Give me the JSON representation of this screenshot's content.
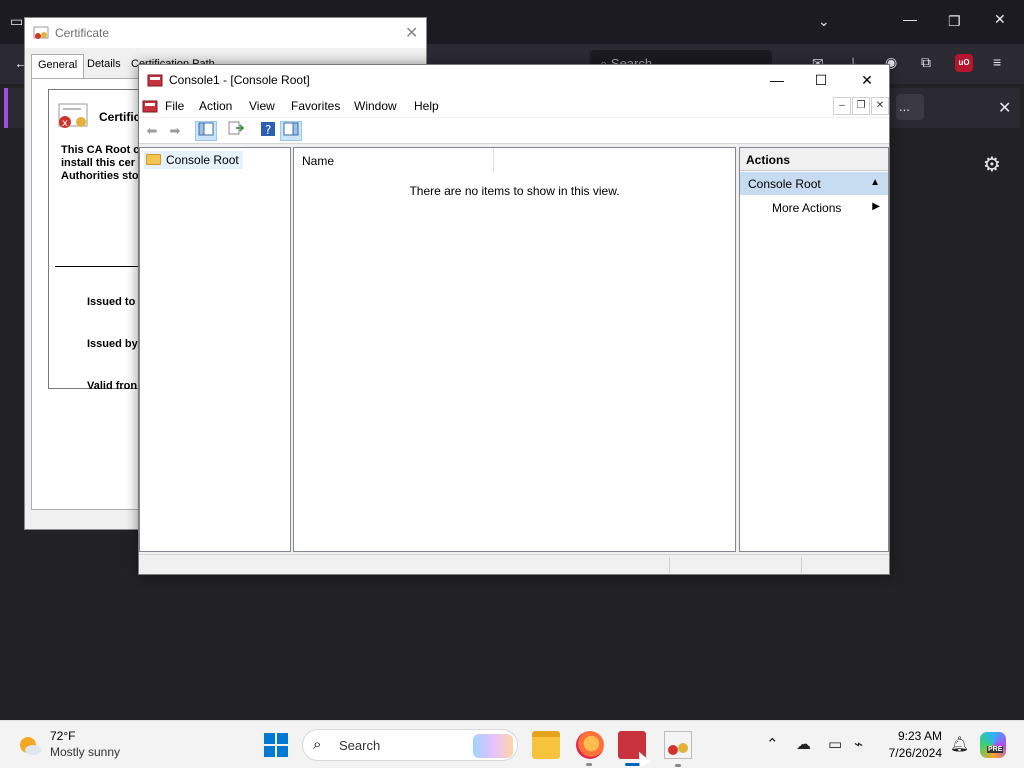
{
  "browser": {
    "nav_search_placeholder": "Search",
    "extension_badge": "uO",
    "notif_chip": "..."
  },
  "certificate_dialog": {
    "title": "Certificate",
    "tabs": [
      "General",
      "Details",
      "Certification Path"
    ],
    "heading": "Certific",
    "body_line1": "This CA Root c",
    "body_line2": "install this cer",
    "body_line3": "Authorities sto",
    "issued_to": "Issued to",
    "issued_by": "Issued by",
    "valid_from": "Valid fron"
  },
  "mmc": {
    "title": "Console1 - [Console Root]",
    "menu": [
      "File",
      "Action",
      "View",
      "Favorites",
      "Window",
      "Help"
    ],
    "tree_root": "Console Root",
    "column_name": "Name",
    "empty_message": "There are no items to show in this view.",
    "actions_header": "Actions",
    "actions_section": "Console Root",
    "actions_more": "More Actions"
  },
  "taskbar": {
    "temperature": "72°F",
    "weather": "Mostly sunny",
    "search_label": "Search",
    "time": "9:23 AM",
    "date": "7/26/2024",
    "copilot_badge": "PRE"
  },
  "colors": {
    "accent": "#0078d4",
    "selection": "#c7dcf0",
    "browser_bg": "#222225"
  }
}
